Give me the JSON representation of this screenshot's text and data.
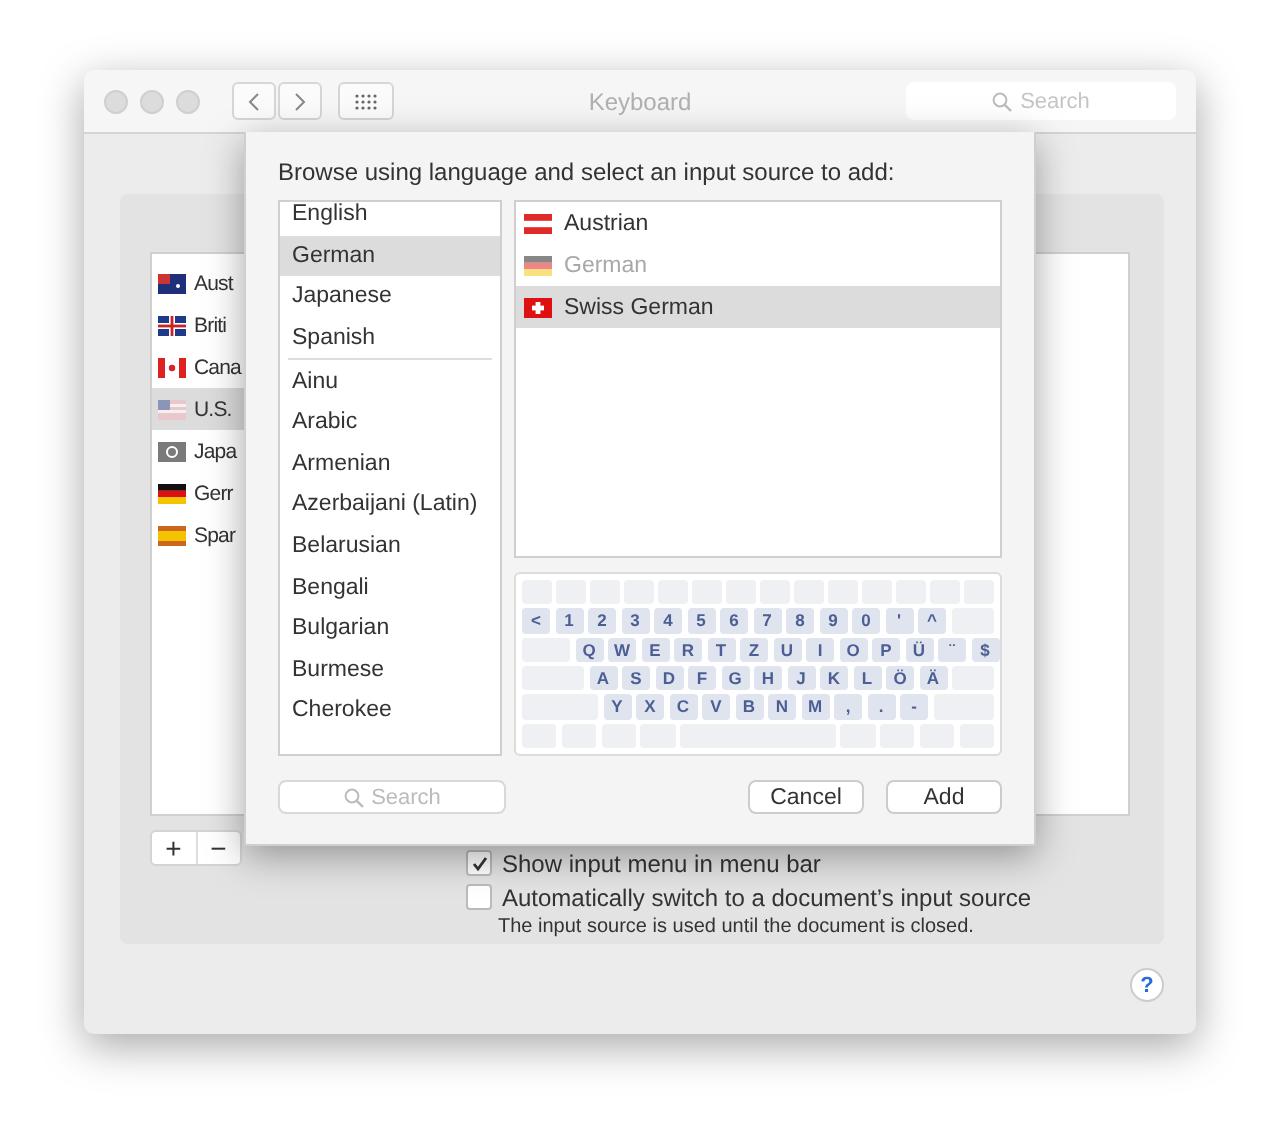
{
  "window": {
    "title": "Keyboard",
    "search": {
      "placeholder": "Search"
    }
  },
  "input_sources": [
    {
      "label": "Aust",
      "kind": "au",
      "selected": false
    },
    {
      "label": "Briti",
      "kind": "gb",
      "selected": false
    },
    {
      "label": "Cana",
      "kind": "ca",
      "selected": false
    },
    {
      "label": "U.S.",
      "kind": "us",
      "selected": true
    },
    {
      "label": "Japa",
      "kind": "ja",
      "selected": false
    },
    {
      "label": "Gerr",
      "kind": "de",
      "selected": false
    },
    {
      "label": "Spar",
      "kind": "es",
      "selected": false
    }
  ],
  "list_buttons": [
    "+",
    "−"
  ],
  "options": [
    {
      "label": "Show input menu in menu bar",
      "checked": true
    },
    {
      "label": "Automatically switch to a document’s input source",
      "checked": false,
      "note": "The input source is used until the document is closed."
    }
  ],
  "help": "?",
  "sheet": {
    "prompt": "Browse using language and select an input source to add:",
    "languages": [
      {
        "label": "English",
        "selected": false,
        "separator_after": false
      },
      {
        "label": "German",
        "selected": true,
        "separator_after": false
      },
      {
        "label": "Japanese",
        "selected": false,
        "separator_after": false
      },
      {
        "label": "Spanish",
        "selected": false,
        "separator_after": true
      },
      {
        "label": "Ainu",
        "selected": false,
        "separator_after": false
      },
      {
        "label": "Arabic",
        "selected": false,
        "separator_after": false
      },
      {
        "label": "Armenian",
        "selected": false,
        "separator_after": false
      },
      {
        "label": "Azerbaijani (Latin)",
        "selected": false,
        "separator_after": false
      },
      {
        "label": "Belarusian",
        "selected": false,
        "separator_after": false
      },
      {
        "label": "Bengali",
        "selected": false,
        "separator_after": false
      },
      {
        "label": "Bulgarian",
        "selected": false,
        "separator_after": false
      },
      {
        "label": "Burmese",
        "selected": false,
        "separator_after": false
      },
      {
        "label": "Cherokee",
        "selected": false,
        "separator_after": false
      }
    ],
    "sources": [
      {
        "label": "Austrian",
        "kind": "at",
        "selected": false,
        "disabled": false
      },
      {
        "label": "German",
        "kind": "de",
        "selected": false,
        "disabled": true
      },
      {
        "label": "Swiss German",
        "kind": "ch",
        "selected": true,
        "disabled": false
      }
    ],
    "keyboard_rows": [
      [
        "<",
        "1",
        "2",
        "3",
        "4",
        "5",
        "6",
        "7",
        "8",
        "9",
        "0",
        "'",
        "^"
      ],
      [
        "Q",
        "W",
        "E",
        "R",
        "T",
        "Z",
        "U",
        "I",
        "O",
        "P",
        "Ü",
        "¨",
        "$"
      ],
      [
        "A",
        "S",
        "D",
        "F",
        "G",
        "H",
        "J",
        "K",
        "L",
        "Ö",
        "Ä"
      ],
      [
        "Y",
        "X",
        "C",
        "V",
        "B",
        "N",
        "M",
        ",",
        ".",
        "-"
      ]
    ],
    "search": {
      "placeholder": "Search"
    },
    "buttons": [
      "Cancel",
      "Add"
    ]
  }
}
